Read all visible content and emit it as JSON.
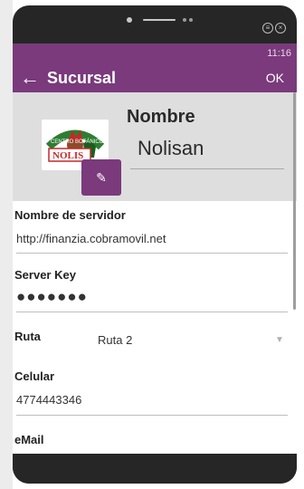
{
  "status_bar": {
    "time": "11:16"
  },
  "app_bar": {
    "title": "Sucursal",
    "ok_label": "OK",
    "back_icon": "←"
  },
  "header": {
    "name_label": "Nombre",
    "name_value": "Nolisan",
    "logo_top_text": "CENTRO BOTÁNICO",
    "logo_brand_text": "NOLIS",
    "edit_icon": "✎"
  },
  "fields": {
    "server_name": {
      "label": "Nombre de servidor",
      "value": "http://finanzia.cobramovil.net"
    },
    "server_key": {
      "label": "Server Key",
      "value": "●●●●●●●"
    },
    "route": {
      "label": "Ruta",
      "value": "Ruta 2"
    },
    "phone": {
      "label": "Celular",
      "value": "4774443346"
    },
    "email": {
      "label": "eMail",
      "value": ""
    }
  },
  "colors": {
    "primary": "#7a3a7c",
    "header_bg": "#dedede",
    "device": "#262626"
  },
  "device": {
    "menu_icon": "≡",
    "close_icon": "×"
  }
}
